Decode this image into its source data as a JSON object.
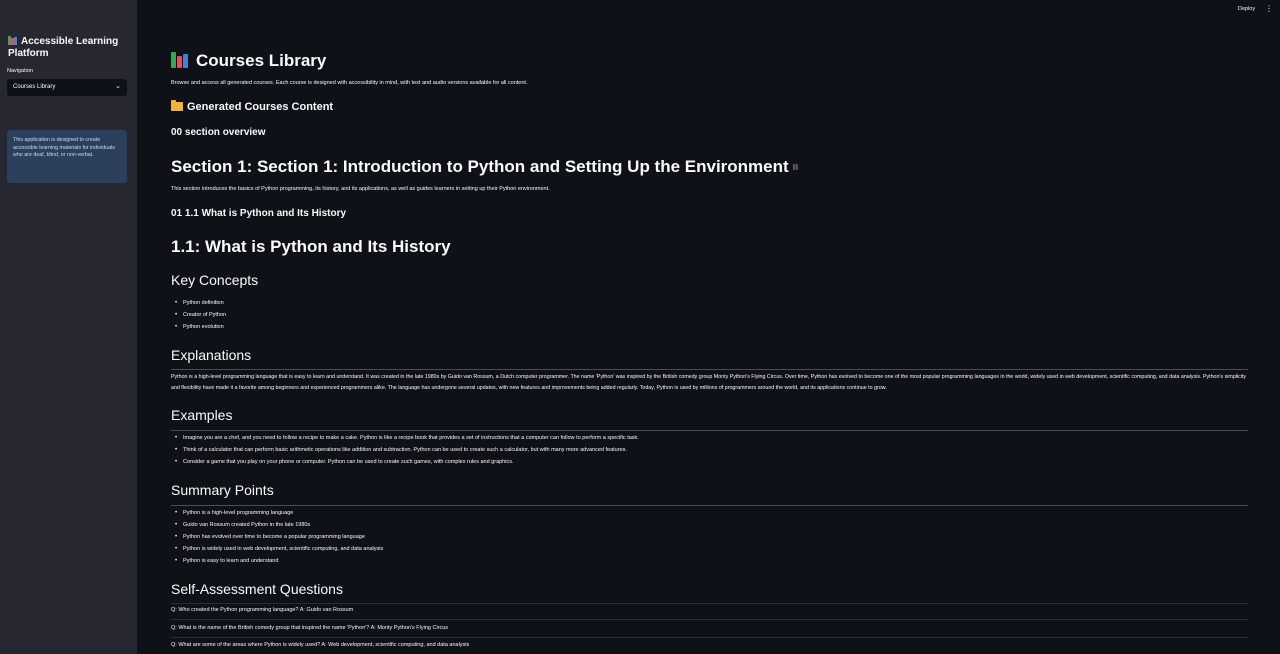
{
  "sidebar": {
    "title": "Accessible Learning Platform",
    "nav_label": "Navigation",
    "nav_selected": "Courses Library",
    "info_text": "This application is designed to create accessible learning materials for individuals who are deaf, blind, or non-verbal."
  },
  "topbar": {
    "deploy_label": "Deploy",
    "menu_glyph": "⋮"
  },
  "main": {
    "page_title": "Courses Library",
    "intro": "Browse and access all generated courses. Each course is designed with accessibility in mind, with text and audio versions available for all content.",
    "generated_heading": "Generated Courses Content",
    "overview_heading": "00 section overview",
    "section_heading": "Section 1: Section 1: Introduction to Python and Setting Up the Environment",
    "section_desc": "This section introduces the basics of Python programming, its history, and its applications, as well as guides learners in setting up their Python environment.",
    "sub_heading": "01 1.1 What is Python and Its History",
    "lesson_heading": "1.1: What is Python and Its History",
    "key_concepts_heading": "Key Concepts",
    "key_concepts": [
      "Python definition",
      "Creator of Python",
      "Python evolution"
    ],
    "explanations_heading": "Explanations",
    "explanation_text": "Python is a high-level programming language that is easy to learn and understand. It was created in the late 1980s by Guido van Rossum, a Dutch computer programmer. The name 'Python' was inspired by the British comedy group Monty Python's Flying Circus. Over time, Python has evolved to become one of the most popular programming languages in the world, widely used in web development, scientific computing, and data analysis. Python's simplicity and flexibility have made it a favorite among beginners and experienced programmers alike. The language has undergone several updates, with new features and improvements being added regularly. Today, Python is used by millions of programmers around the world, and its applications continue to grow.",
    "examples_heading": "Examples",
    "examples": [
      "Imagine you are a chef, and you need to follow a recipe to make a cake. Python is like a recipe book that provides a set of instructions that a computer can follow to perform a specific task.",
      "Think of a calculator that can perform basic arithmetic operations like addition and subtraction. Python can be used to create such a calculator, but with many more advanced features.",
      "Consider a game that you play on your phone or computer. Python can be used to create such games, with complex rules and graphics."
    ],
    "summary_heading": "Summary Points",
    "summary_points": [
      "Python is a high-level programming language",
      "Guido van Rossum created Python in the late 1980s",
      "Python has evolved over time to become a popular programming language",
      "Python is widely used in web development, scientific computing, and data analysis",
      "Python is easy to learn and understand"
    ],
    "self_assessment_heading": "Self-Assessment Questions",
    "questions": [
      "Q: Who created the Python programming language? A: Guido van Rossum",
      "Q: What is the name of the British comedy group that inspired the name 'Python'? A: Monty Python's Flying Circus",
      "Q: What are some of the areas where Python is widely used? A: Web development, scientific computing, and data analysis"
    ]
  }
}
